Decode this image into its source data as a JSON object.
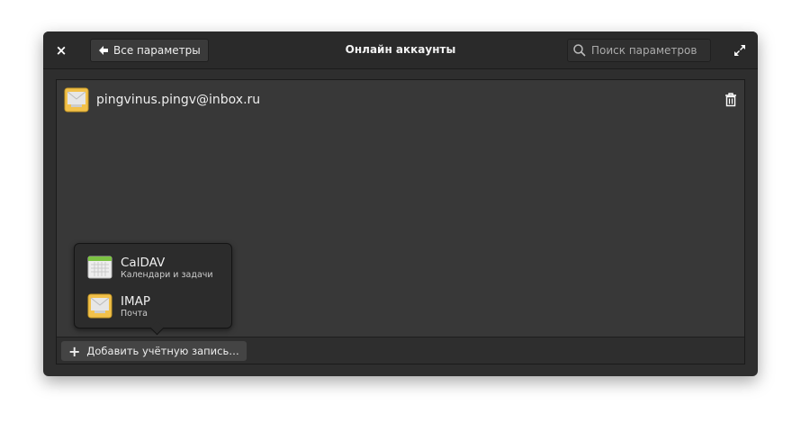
{
  "header": {
    "close_label": "×",
    "back_label": "Все параметры",
    "title": "Онлайн аккаунты",
    "search_placeholder": "Поиск параметров"
  },
  "account": {
    "email": "pingvinus.pingv@inbox.ru",
    "icon": "mail-icon"
  },
  "popover": {
    "items": [
      {
        "title": "CalDAV",
        "subtitle": "Календари и задачи",
        "icon": "calendar-icon"
      },
      {
        "title": "IMAP",
        "subtitle": "Почта",
        "icon": "mail-icon"
      }
    ]
  },
  "footer": {
    "add_label": "Добавить учётную запись…",
    "add_icon": "+"
  }
}
